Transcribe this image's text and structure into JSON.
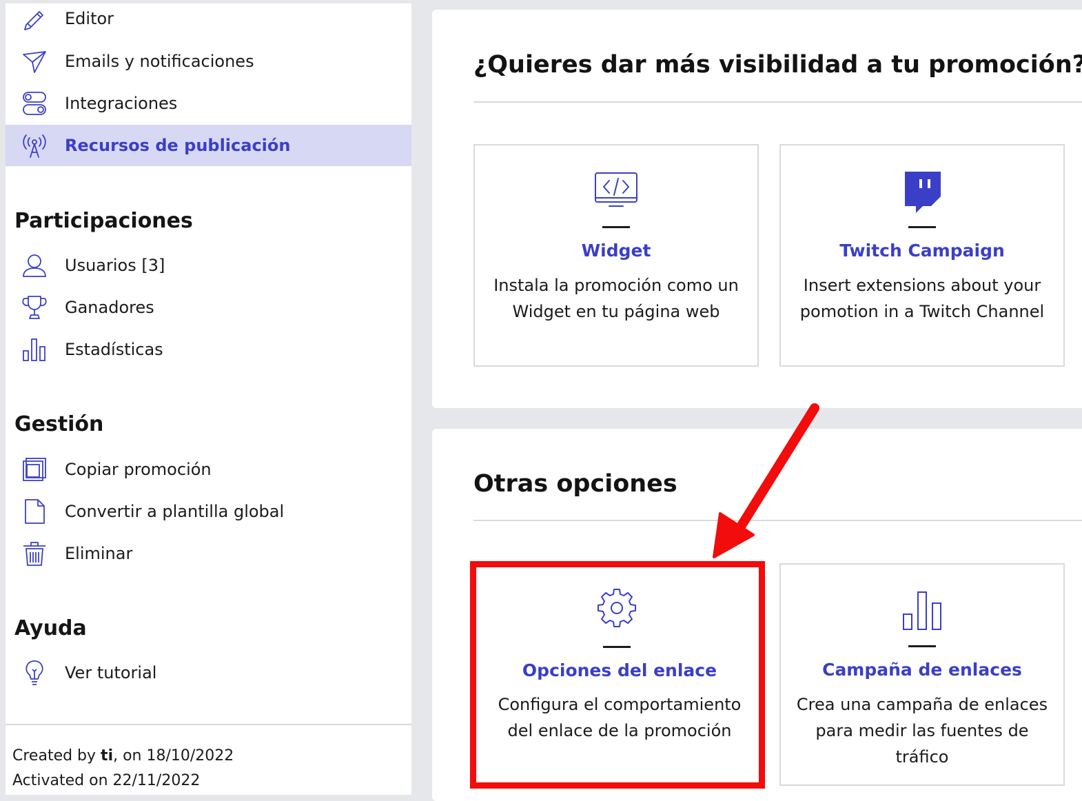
{
  "sidebar": {
    "top_items": [
      {
        "label": "Editor",
        "icon": "pencil-icon"
      },
      {
        "label": "Emails y notificaciones",
        "icon": "paper-plane-icon"
      },
      {
        "label": "Integraciones",
        "icon": "toggles-icon"
      },
      {
        "label": "Recursos de publicación",
        "icon": "broadcast-antenna-icon",
        "active": true
      }
    ],
    "sections": [
      {
        "title": "Participaciones",
        "items": [
          {
            "label": "Usuarios [3]",
            "icon": "user-icon"
          },
          {
            "label": "Ganadores",
            "icon": "trophy-icon"
          },
          {
            "label": "Estadísticas",
            "icon": "bar-chart-icon"
          }
        ]
      },
      {
        "title": "Gestión",
        "items": [
          {
            "label": "Copiar promoción",
            "icon": "copy-icon"
          },
          {
            "label": "Convertir a plantilla global",
            "icon": "document-icon"
          },
          {
            "label": "Eliminar",
            "icon": "trash-icon"
          }
        ]
      },
      {
        "title": "Ayuda",
        "items": [
          {
            "label": "Ver tutorial",
            "icon": "lightbulb-icon"
          }
        ]
      }
    ],
    "footer": {
      "created_prefix": "Created by ",
      "created_user": "ti",
      "created_suffix": ", on 18/10/2022",
      "activated": "Activated on 22/11/2022"
    }
  },
  "visibility_panel": {
    "title": "¿Quieres dar más visibilidad a tu promoción?",
    "cards": [
      {
        "title": "Widget",
        "description": "Instala la promoción como un Widget en tu página web",
        "icon": "code-monitor-icon"
      },
      {
        "title": "Twitch Campaign",
        "description": "Insert extensions about your pomotion in a Twitch Channel",
        "icon": "twitch-icon"
      }
    ]
  },
  "other_panel": {
    "title": "Otras opciones",
    "cards": [
      {
        "title": "Opciones del enlace",
        "description": "Configura el comportamiento del enlace de la promoción",
        "icon": "gear-icon",
        "highlighted": true
      },
      {
        "title": "Campaña de enlaces",
        "description": "Crea una campaña de enlaces para medir las fuentes de tráfico",
        "icon": "bar-chart-icon"
      }
    ]
  },
  "colors": {
    "accent": "#3a3fc7",
    "active_bg": "#d7d8f4",
    "highlight": "#f30c0c",
    "page_bg": "#e6e7ea"
  }
}
